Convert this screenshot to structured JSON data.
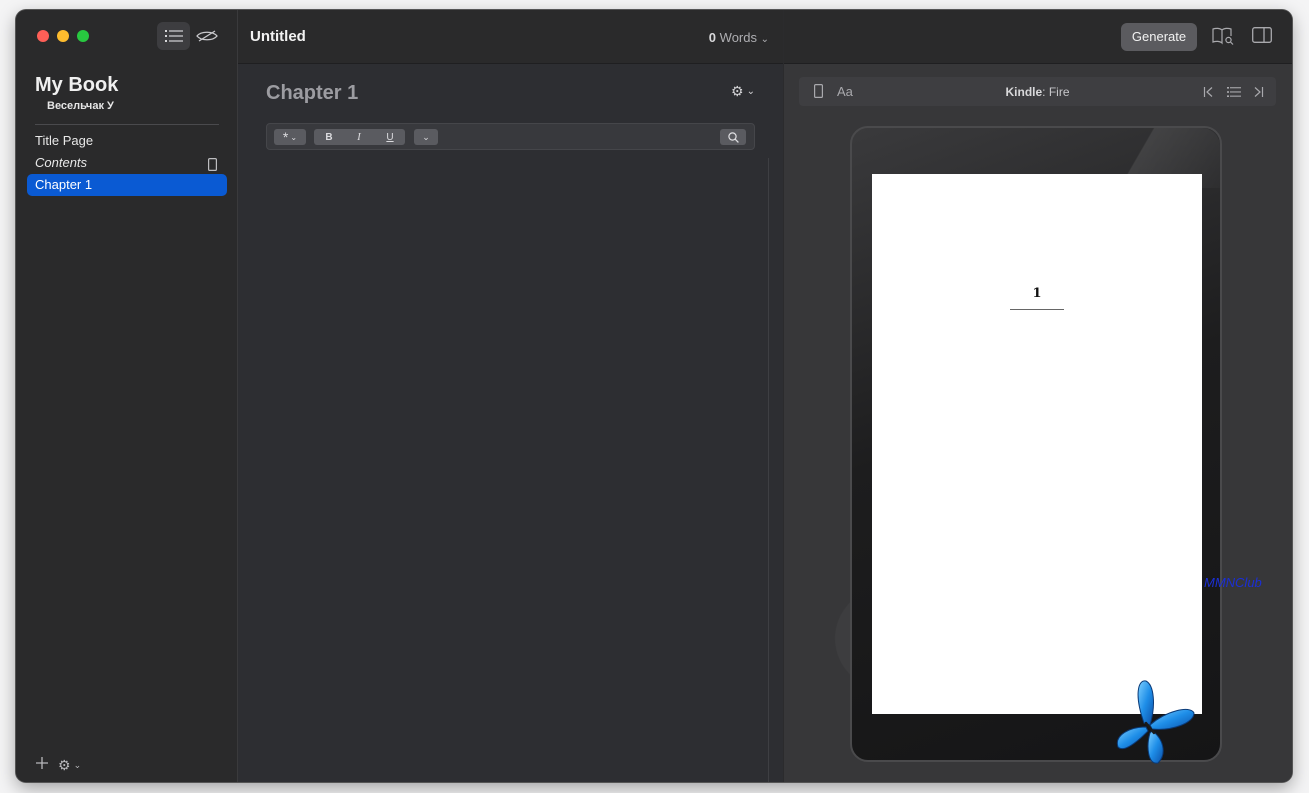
{
  "sidebar": {
    "book_title": "My Book",
    "author": "Весельчак У",
    "items": [
      {
        "label": "Title Page",
        "selected": false,
        "italic": false
      },
      {
        "label": "Contents",
        "selected": false,
        "italic": true
      },
      {
        "label": "Chapter 1",
        "selected": true,
        "italic": false
      }
    ]
  },
  "editor": {
    "document_title": "Untitled",
    "word_count": "0",
    "word_count_label": "Words",
    "chapter_title": "Chapter 1",
    "format_buttons": {
      "bold": "B",
      "italic": "I",
      "underline": "U"
    }
  },
  "preview": {
    "generate_label": "Generate",
    "font_label": "Aa",
    "device_brand": "Kindle",
    "device_model": ": Fire",
    "page_number": "1",
    "watermark": "MMNClub"
  },
  "colors": {
    "selection": "#0a5ad3",
    "window_bg": "#2b2b2d"
  }
}
